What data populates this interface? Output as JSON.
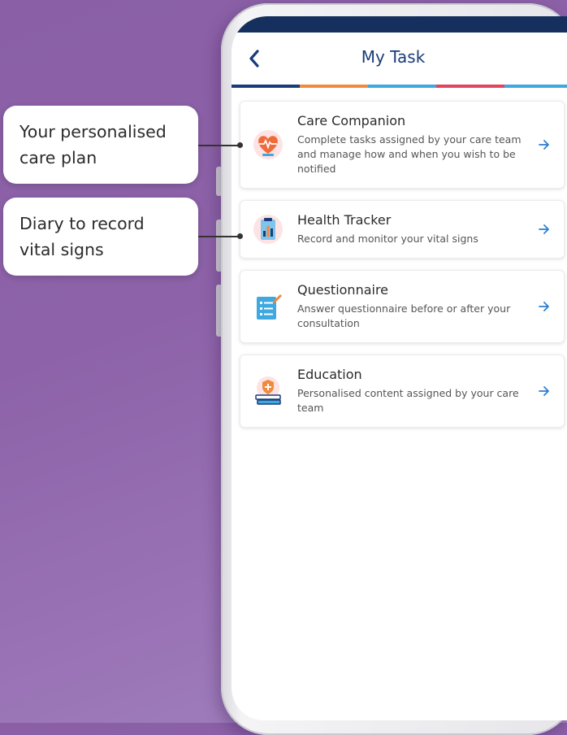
{
  "callouts": [
    {
      "text": "Your personalised care plan"
    },
    {
      "text": "Diary to record vital signs"
    }
  ],
  "header": {
    "title": "My Task",
    "back_icon": "chevron-left-icon",
    "stripe_colors": [
      "#1a3c7a",
      "#f08a3c",
      "#3ea9e0",
      "#e0465e",
      "#3ea9e0"
    ]
  },
  "tasks": [
    {
      "title": "Care Companion",
      "description": "Complete tasks assigned by your care team and manage how and when you wish to be notified",
      "icon": "heart-monitor-icon"
    },
    {
      "title": "Health Tracker",
      "description": "Record and monitor your vital signs",
      "icon": "clipboard-chart-icon"
    },
    {
      "title": "Questionnaire",
      "description": "Answer questionnaire before or after your consultation",
      "icon": "checklist-icon"
    },
    {
      "title": "Education",
      "description": "Personalised content assigned by your care team",
      "icon": "books-shield-icon"
    }
  ],
  "colors": {
    "primary": "#1a3c7a",
    "arrow": "#2d7fd1",
    "accent_orange": "#f08a3c"
  }
}
